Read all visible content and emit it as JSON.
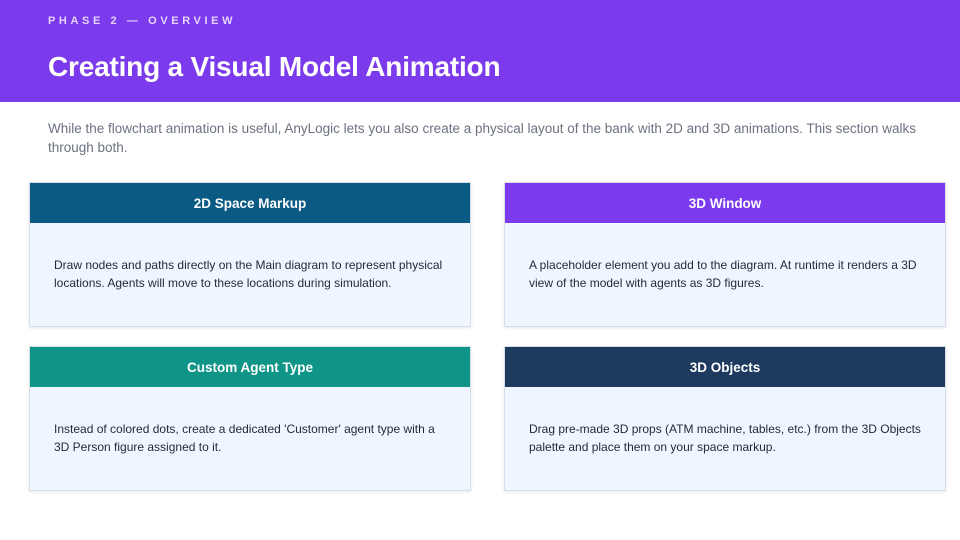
{
  "header": {
    "eyebrow": "PHASE 2 — OVERVIEW",
    "title": "Creating a Visual Model Animation"
  },
  "intro": "While the flowchart animation is useful, AnyLogic lets you also create a physical layout of the bank with 2D and 3D animations. This section walks through both.",
  "cards": [
    {
      "title": "2D Space Markup",
      "color": "#0b5a83",
      "body": "Draw nodes and paths directly on the Main diagram to represent physical locations. Agents will move to these locations during simulation."
    },
    {
      "title": "3D Window",
      "color": "#7c3aed",
      "body": "A placeholder element you add to the diagram. At runtime it renders a 3D view of the model with agents as 3D figures."
    },
    {
      "title": "Custom Agent Type",
      "color": "#0f9488",
      "body": "Instead of colored dots, create a dedicated 'Customer' agent type with a 3D Person figure assigned to it."
    },
    {
      "title": "3D Objects",
      "color": "#1e3a5f",
      "body": "Drag pre-made 3D props (ATM machine, tables, etc.) from the 3D Objects palette and place them on your space markup."
    }
  ]
}
